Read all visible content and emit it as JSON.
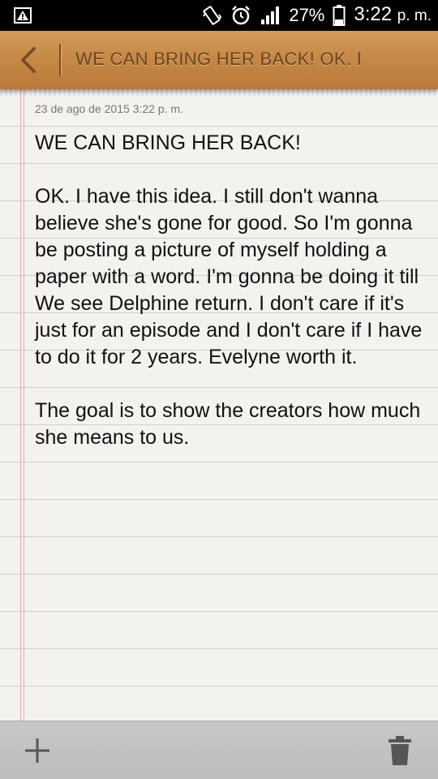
{
  "status_bar": {
    "battery_pct": "27%",
    "time": "3:22",
    "ampm": "p. m.",
    "icons": [
      "warning-icon",
      "vibrate-icon",
      "alarm-icon",
      "signal-icon",
      "battery-icon"
    ]
  },
  "header": {
    "title": "WE CAN BRING HER BACK!  OK. I"
  },
  "note": {
    "date": "23 de ago de 2015 3:22 p. m.",
    "title_line": "WE CAN BRING HER BACK!",
    "paragraph1": "OK. I have this idea. I still don't wanna believe she's gone for good. So I'm gonna be posting a picture of myself holding a paper with a word. I'm gonna be doing it till We see Delphine return. I don't care if it's just for an episode and I don't care if I have to do it for 2 years. Evelyne worth it.",
    "paragraph2": "The goal is to show the creators how much she means to us."
  },
  "bottom_bar": {
    "icons": [
      "add-icon",
      "trash-icon"
    ]
  },
  "colors": {
    "header_wood": "#c68a48",
    "header_text": "#6a4320",
    "paper": "#f3f2ee",
    "margin_line": "#e8a8a2"
  }
}
